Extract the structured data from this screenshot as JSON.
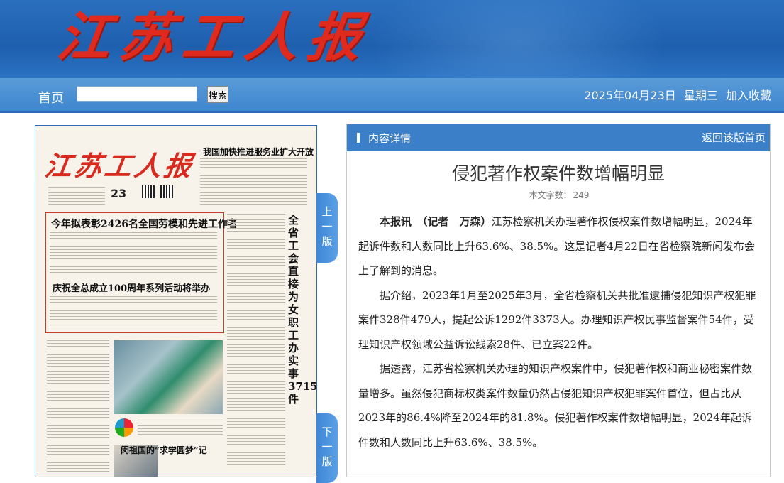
{
  "header": {
    "logo_text": "江苏工人报"
  },
  "nav": {
    "home": "首页",
    "search_placeholder": "",
    "search_button": "搜索",
    "date": "2025年04月23日",
    "weekday": "星期三",
    "favorite": "加入收藏"
  },
  "paper": {
    "logo": "江苏工人报",
    "page_number": "23",
    "headlines": [
      "我国加快推进服务业扩大开放",
      "今年拟表彰2426名全国劳模和先进工作者",
      "庆祝全总成立100周年系列活动将举办",
      "闵祖国的“求学圆梦”记"
    ],
    "vertical_headline": "全省工会直接为女职工办实事3715件"
  },
  "page_tabs": {
    "prev": "上一版",
    "next": "下一版"
  },
  "article": {
    "section_title": "内容详情",
    "back_link": "返回该版首页",
    "title": "侵犯著作权案件数增幅明显",
    "word_count_label": "本文字数：",
    "word_count": "249",
    "lead": "本报讯　（记者　万森）",
    "paragraphs": [
      "江苏检察机关办理著作权侵权案件数增幅明显，2024年起诉件数和人数同比上升63.6%、38.5%。这是记者4月22日在省检察院新闻发布会上了解到的消息。",
      "据介绍，2023年1月至2025年3月，全省检察机关共批准逮捕侵犯知识产权犯罪案件328件479人，提起公诉1292件3373人。办理知识产权民事监督案件54件，受理知识产权领域公益诉讼线索28件、已立案22件。",
      "据透露，江苏省检察机关办理的知识产权案件中，侵犯著作权和商业秘密案件数量增多。虽然侵犯商标权类案件数量仍然占侵犯知识产权犯罪案件首位，但占比从2023年的86.4%降至2024年的81.8%。侵犯著作权案件数增幅明显，2024年起诉件数和人数同比上升63.6%、38.5%。"
    ]
  },
  "colors": {
    "header_blue": "#2a6fbe",
    "logo_red": "#e02a1e",
    "panel_blue": "#3c7fc9"
  }
}
